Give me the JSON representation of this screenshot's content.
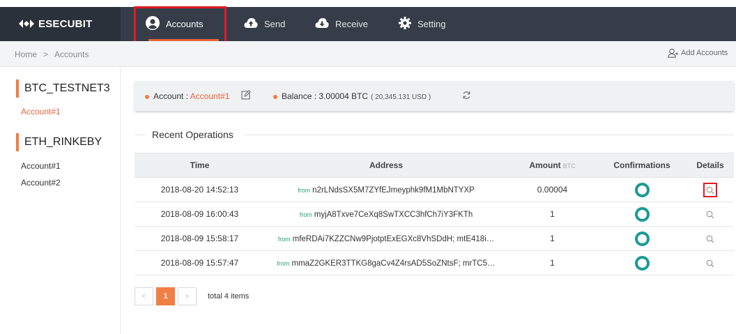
{
  "brand": {
    "name": "ESECUBIT"
  },
  "nav": {
    "items": [
      {
        "label": "Accounts",
        "icon": "user-circle-icon",
        "active": true
      },
      {
        "label": "Send",
        "icon": "cloud-upload-icon"
      },
      {
        "label": "Receive",
        "icon": "cloud-download-icon"
      },
      {
        "label": "Setting",
        "icon": "gear-icon"
      }
    ]
  },
  "breadcrumb": {
    "home": "Home",
    "separator": ">",
    "current": "Accounts"
  },
  "actions": {
    "add_accounts": "Add Accounts"
  },
  "sidebar": {
    "groups": [
      {
        "coin": "BTC_TESTNET3",
        "accounts": [
          "Account#1"
        ]
      },
      {
        "coin": "ETH_RINKEBY",
        "accounts": [
          "Account#1",
          "Account#2"
        ]
      }
    ]
  },
  "summary": {
    "account_label": "Account :",
    "account_name": "Account#1",
    "balance_label": "Balance :",
    "balance_value": "3.00004 BTC",
    "balance_fiat": "( 20,345.131 USD )"
  },
  "operations": {
    "title": "Recent Operations",
    "columns": {
      "time": "Time",
      "address": "Address",
      "amount": "Amount",
      "amount_unit": "BTC",
      "confirmations": "Confirmations",
      "details": "Details"
    },
    "rows": [
      {
        "time": "2018-08-20 14:52:13",
        "from": "from",
        "address": "n2rLNdsSX5M7ZYfEJmeyphk9fM1MbNTYXP",
        "amount": "0.00004"
      },
      {
        "time": "2018-08-09 16:00:43",
        "from": "from",
        "address": "myjA8Txve7CeXq8SwTXCC3hfCh7iY3FKTh",
        "amount": "1"
      },
      {
        "time": "2018-08-09 15:58:17",
        "from": "from",
        "address": "mfeRDAi7KZZCNw9PjotptExEGXc8VhSDdH; mtE418i…",
        "amount": "1"
      },
      {
        "time": "2018-08-09 15:57:47",
        "from": "from",
        "address": "mmaZ2GKER3TTKG8gaCv4Z4rsAD5SoZNtsF; mrTC5…",
        "amount": "1"
      }
    ]
  },
  "pagination": {
    "prev": "<",
    "current": "1",
    "next": ">",
    "total": "total 4 items"
  },
  "colors": {
    "accent": "#e8643c",
    "topbar": "#363d48",
    "ring": "#1b9a93",
    "highlight": "#e21a22"
  }
}
